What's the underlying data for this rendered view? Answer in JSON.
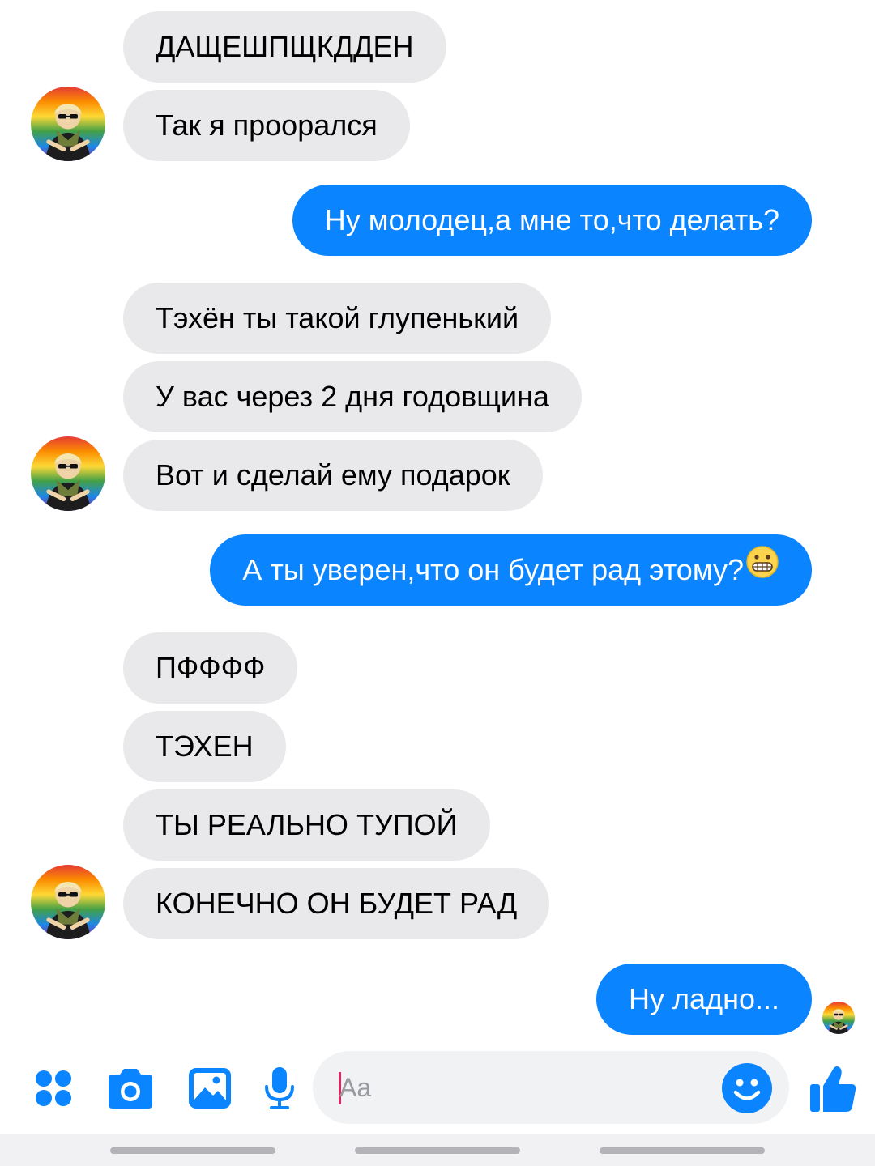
{
  "messages": [
    {
      "side": "incoming",
      "text": "ДАЩЕШПЩКДДЕН"
    },
    {
      "side": "incoming",
      "text": "Так я проорался"
    },
    {
      "side": "outgoing",
      "text": "Ну молодец,а мне то,что делать?"
    },
    {
      "side": "incoming",
      "text": "Тэхён ты такой глупенький"
    },
    {
      "side": "incoming",
      "text": "У вас через 2 дня годовщина"
    },
    {
      "side": "incoming",
      "text": "Вот и сделай ему подарок"
    },
    {
      "side": "outgoing",
      "text": "А ты уверен,что он будет рад этому?",
      "emoji": "grimacing-face"
    },
    {
      "side": "incoming",
      "text": "ПФФФФ"
    },
    {
      "side": "incoming",
      "text": "ТЭХЕН"
    },
    {
      "side": "incoming",
      "text": "ТЫ РЕАЛЬНО ТУПОЙ"
    },
    {
      "side": "incoming",
      "text": "КОНЕЧНО ОН БУДЕТ РАД"
    },
    {
      "side": "outgoing",
      "text": "Ну ладно..."
    }
  ],
  "composer": {
    "placeholder": "Aa",
    "tools": [
      "apps-icon",
      "camera-icon",
      "gallery-icon",
      "microphone-icon"
    ],
    "emoji_button": "smile-icon",
    "send_button": "thumbs-up-icon"
  },
  "colors": {
    "outgoing_bubble": "#0a84ff",
    "incoming_bubble": "#e9e9eb",
    "accent": "#0a84ff"
  }
}
